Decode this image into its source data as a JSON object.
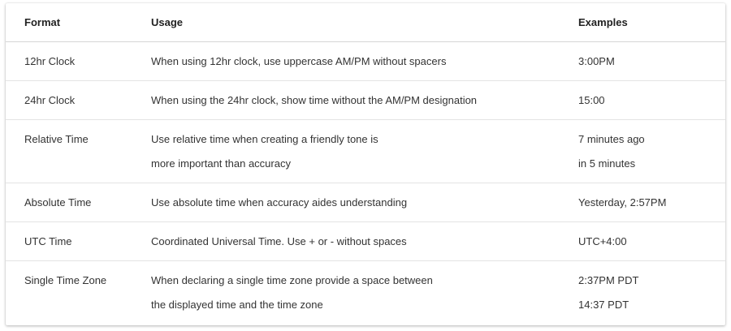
{
  "table": {
    "headers": {
      "format": "Format",
      "usage": "Usage",
      "examples": "Examples"
    },
    "rows": [
      {
        "format": "12hr Clock",
        "usage": [
          "When using 12hr clock, use uppercase AM/PM without spacers"
        ],
        "examples": [
          "3:00PM"
        ]
      },
      {
        "format": "24hr Clock",
        "usage": [
          "When using the 24hr clock, show time without the AM/PM designation"
        ],
        "examples": [
          "15:00"
        ]
      },
      {
        "format": "Relative Time",
        "usage": [
          "Use relative time when creating a friendly tone is",
          "more important than accuracy"
        ],
        "examples": [
          "7 minutes ago",
          "in 5 minutes"
        ]
      },
      {
        "format": "Absolute Time",
        "usage": [
          "Use absolute time when accuracy aides understanding"
        ],
        "examples": [
          "Yesterday, 2:57PM"
        ]
      },
      {
        "format": "UTC Time",
        "usage": [
          "Coordinated Universal Time. Use + or - without spaces"
        ],
        "examples": [
          "UTC+4:00"
        ]
      },
      {
        "format": "Single Time Zone",
        "usage": [
          "When declaring a single time zone provide a space between",
          "the displayed time and the time zone"
        ],
        "examples": [
          "2:37PM PDT",
          "14:37 PDT"
        ]
      }
    ]
  }
}
